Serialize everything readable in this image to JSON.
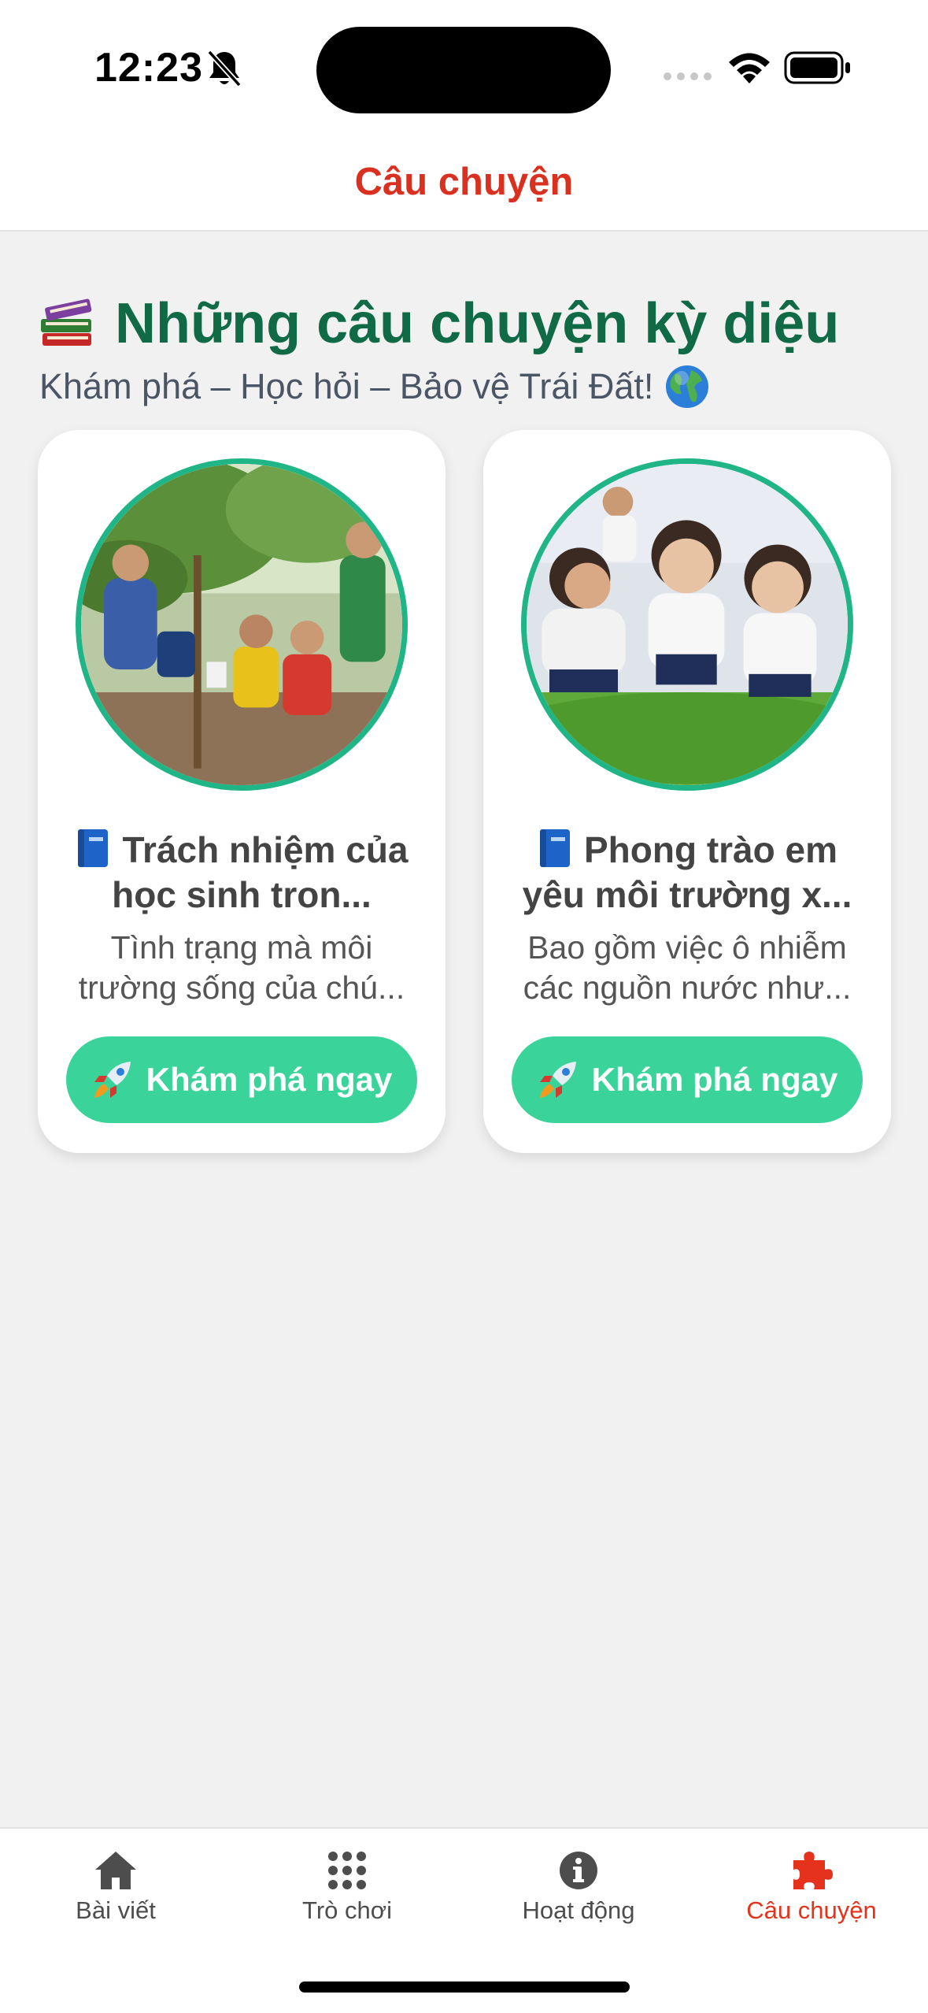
{
  "status_bar": {
    "time": "12:23",
    "icons": [
      "bell-slash-icon",
      "cellular-signal-icon",
      "wifi-icon",
      "battery-icon"
    ]
  },
  "header": {
    "title": "Câu chuyện"
  },
  "main": {
    "heading_icon": "books-emoji",
    "heading": "Những câu chuyện kỳ diệu",
    "subtitle": "Khám phá – Học hỏi – Bảo vệ Trái Đất!",
    "subtitle_icon": "globe-emoji",
    "cards": [
      {
        "image": "students-planting-trees-photo",
        "title_icon": "blue-book-emoji",
        "title": "Trách nhiệm của học sinh tron...",
        "description": "Tình trạng mà môi trường sống của chú...",
        "button_icon": "rocket-emoji",
        "button_label": "Khám phá ngay"
      },
      {
        "image": "children-planting-seedlings-photo",
        "title_icon": "blue-book-emoji",
        "title": "Phong trào em yêu môi trường x...",
        "description": "Bao gồm việc ô nhiễm các nguồn nước như...",
        "button_icon": "rocket-emoji",
        "button_label": "Khám phá ngay"
      }
    ]
  },
  "tab_bar": {
    "items": [
      {
        "label": "Bài viết",
        "icon": "home-icon",
        "active": false
      },
      {
        "label": "Trò chơi",
        "icon": "grid-dots-icon",
        "active": false
      },
      {
        "label": "Hoạt động",
        "icon": "info-circle-icon",
        "active": false
      },
      {
        "label": "Câu chuyện",
        "icon": "puzzle-piece-icon",
        "active": true
      }
    ]
  },
  "colors": {
    "accent_red": "#d9301f",
    "heading_green": "#0f6a45",
    "button_green": "#3ad49b",
    "image_border_green": "#1fb587",
    "background": "#f1f1f1"
  }
}
